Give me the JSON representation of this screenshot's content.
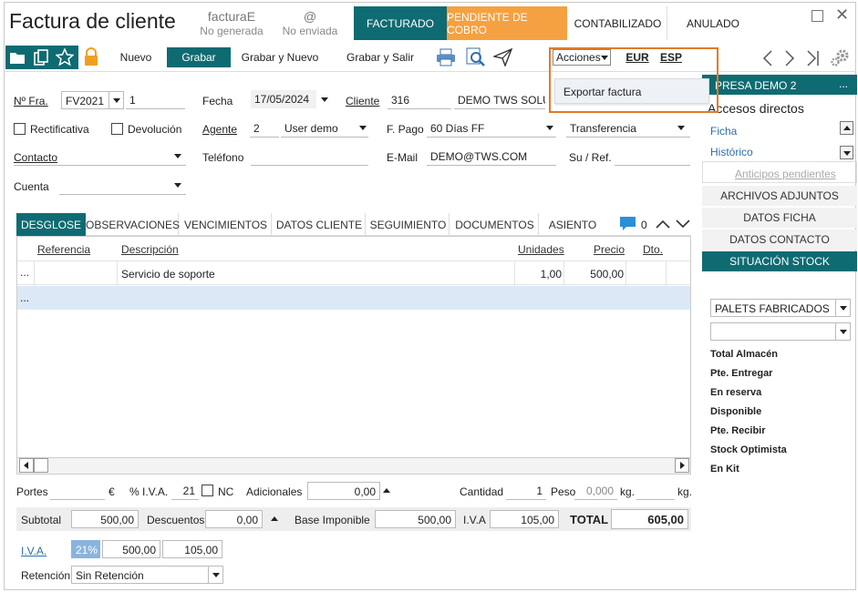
{
  "header": {
    "title": "Factura de cliente",
    "factura_e_label": "facturaE",
    "factura_e_status": "No generada",
    "email_icon": "@",
    "email_status": "No enviada",
    "statuses": [
      "FACTURADO",
      "PENDIENTE DE COBRO",
      "CONTABILIZADO",
      "ANULADO"
    ]
  },
  "toolbar": {
    "nuevo": "Nuevo",
    "grabar": "Grabar",
    "grabar_nuevo": "Grabar y Nuevo",
    "grabar_salir": "Grabar y Salir",
    "acciones": "Acciones",
    "currency": "EUR",
    "language": "ESP"
  },
  "dropdown": {
    "export": "Exportar factura"
  },
  "form": {
    "nfra_label": "Nº Fra.",
    "serie": "FV2021",
    "numero": "1",
    "fecha_label": "Fecha",
    "fecha": "17/05/2024",
    "cliente_label": "Cliente",
    "cliente_code": "316",
    "cliente_name": "DEMO TWS SOLUTI",
    "rectificativa": "Rectificativa",
    "devolucion": "Devolución",
    "agente_label": "Agente",
    "agente_code": "2",
    "agente_name": "User demo",
    "fpago_label": "F. Pago",
    "fpago": "60 Días FF",
    "transferencia": "Transferencia",
    "contacto_label": "Contacto",
    "telefono_label": "Teléfono",
    "email_label": "E-Mail",
    "email": "DEMO@TWS.COM",
    "suref_label": "Su / Ref.",
    "cuenta_label": "Cuenta"
  },
  "tabs": [
    "DESGLOSE",
    "OBSERVACIONES",
    "VENCIMIENTOS",
    "DATOS CLIENTE",
    "SEGUIMIENTO",
    "DOCUMENTOS",
    "ASIENTO"
  ],
  "comment_count": "0",
  "grid": {
    "headers": [
      "Referencia",
      "Descripción",
      "Unidades",
      "Precio",
      "Dto."
    ],
    "rows": [
      {
        "marker": "...",
        "descripcion": "Servicio de soporte",
        "unidades": "1,00",
        "precio": "500,00"
      },
      {
        "marker": "..."
      }
    ]
  },
  "footer": {
    "portes_label": "Portes",
    "euro": "€",
    "iva_pct_label": "% I.V.A.",
    "iva_pct": "21",
    "nc_label": "NC",
    "adicionales_label": "Adicionales",
    "adicionales": "0,00",
    "cantidad_label": "Cantidad",
    "cantidad": "1",
    "peso_label": "Peso",
    "peso": "0,000",
    "kg1": "kg.",
    "kg2": "kg.",
    "subtotal_label": "Subtotal",
    "subtotal": "500,00",
    "descuentos_label": "Descuentos",
    "descuentos": "0,00",
    "base_label": "Base Imponible",
    "base": "500,00",
    "iva_label": "I.V.A",
    "iva": "105,00",
    "total_label": "TOTAL",
    "total": "605,00",
    "iva_breakdown_label": "I.V.A.",
    "iva_rate": "21%",
    "iva_base": "500,00",
    "iva_amount": "105,00",
    "retencion_label": "Retención",
    "retencion": "Sin Retención"
  },
  "sidebar": {
    "empresa": "PRESA DEMO 2",
    "more": "...",
    "accesos": "Accesos directos",
    "ficha": "Ficha",
    "historico": "Histórico",
    "anticipos": "Anticipos pendientes",
    "archivos": "ARCHIVOS ADJUNTOS",
    "datos_ficha": "DATOS FICHA",
    "datos_contacto": "DATOS CONTACTO",
    "situacion_stock": "SITUACIÓN STOCK",
    "palets": "PALETS FABRICADOS",
    "stock_items": [
      "Total Almacén",
      "Pte. Entregar",
      "En reserva",
      "Disponible",
      "Pte. Recibir",
      "Stock Optimista",
      "En Kit"
    ]
  },
  "colors": {
    "teal": "#0f6b72",
    "orange": "#f5a142",
    "highlight_row": "#dbe9f7",
    "dropdown_border": "#e07b2a"
  }
}
